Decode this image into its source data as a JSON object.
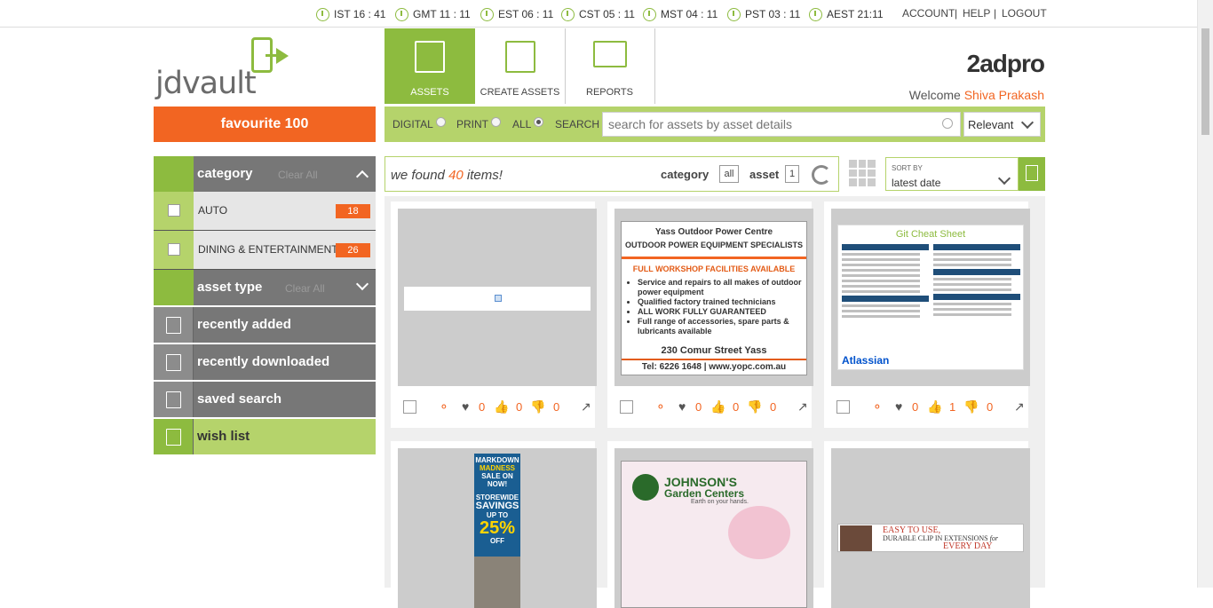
{
  "topbar": {
    "timezones": [
      "IST 16 : 41",
      "GMT 11 : 11",
      "EST 06 : 11",
      "CST 05 : 11",
      "MST 04 : 11",
      "PST 03 : 11",
      "AEST 21:11"
    ],
    "account": "ACCOUNT",
    "sep1": "|",
    "help": "HELP",
    "sep2": "|",
    "logout": "LOGOUT"
  },
  "logo": {
    "text": "jdvault"
  },
  "brand": {
    "name": "2adpro",
    "welcome": "Welcome",
    "user": "Shiva Prakash"
  },
  "favourite": "favourite 100",
  "tabs": [
    {
      "label": "ASSETS",
      "icon": "document-list-icon"
    },
    {
      "label": "CREATE ASSETS",
      "icon": "edit-document-icon"
    },
    {
      "label": "REPORTS",
      "icon": "chart-board-icon"
    }
  ],
  "search": {
    "filters": [
      "DIGITAL",
      "PRINT",
      "ALL"
    ],
    "selected_filter": "ALL",
    "search_label": "SEARCH",
    "placeholder": "search for assets by asset details",
    "sort": "Relevant"
  },
  "sidebar": {
    "category": {
      "title": "category",
      "clear": "Clear All"
    },
    "items": [
      {
        "label": "AUTO",
        "count": "18"
      },
      {
        "label": "DINING & ENTERTAINMENT",
        "count": "26"
      }
    ],
    "asset_type": {
      "title": "asset type",
      "clear": "Clear All"
    },
    "nav": [
      "recently added",
      "recently downloaded",
      "saved search",
      "wish list"
    ]
  },
  "results": {
    "prefix": "we found",
    "count": "40",
    "suffix": "items!",
    "category_label": "category",
    "category_value": "all",
    "asset_label": "asset",
    "asset_value": "1"
  },
  "sort": {
    "title": "SORT BY",
    "value": "latest date"
  },
  "cards": [
    {
      "likes": "0",
      "thumbs_up": "0",
      "thumbs_down": "0"
    },
    {
      "likes": "0",
      "thumbs_up": "0",
      "thumbs_down": "0"
    },
    {
      "likes": "0",
      "thumbs_up": "1",
      "thumbs_down": "0"
    }
  ],
  "ads": {
    "yass": {
      "title": "Yass Outdoor Power Centre",
      "subtitle": "OUTDOOR POWER EQUIPMENT SPECIALISTS",
      "headline": "FULL WORKSHOP FACILITIES AVAILABLE",
      "bullets": [
        "Service and repairs to all makes of outdoor power equipment",
        "Qualified factory trained technicians",
        "ALL WORK FULLY GUARANTEED",
        "Full range of accessories, spare parts & lubricants available"
      ],
      "street": "230 Comur Street Yass",
      "tel": "Tel: 6226 1648   |   www.yopc.com.au"
    },
    "git": {
      "title": "Git Cheat Sheet",
      "brand": "Atlassian"
    },
    "markdown": {
      "l1": "MARKDOWN",
      "l2": "MADNESS",
      "l3": "SALE ON NOW!",
      "l4": "STOREWIDE",
      "l5": "SAVINGS",
      "l6": "UP TO",
      "l7": "25%",
      "l8": "OFF"
    },
    "johnson": {
      "name": "JOHNSON'S",
      "sub": "Garden Centers",
      "tag": "Earth on your hands."
    },
    "clip": {
      "l1": "EASY TO USE,",
      "l2": "DURABLE CLIP IN EXTENSIONS",
      "l3": "for",
      "l4": "EVERY DAY"
    }
  },
  "colors": {
    "green": "#8dbb3f",
    "light_green": "#b5d36b",
    "orange": "#f26522",
    "gray": "#777777"
  }
}
